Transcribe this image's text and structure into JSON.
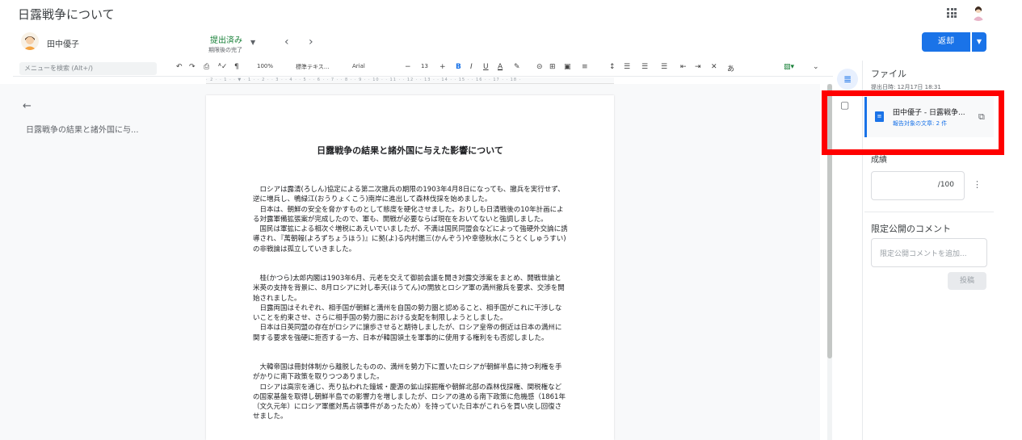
{
  "app": {
    "title": "日露戦争について"
  },
  "student": {
    "name": "田中優子",
    "status": "提出済み",
    "status_sub": "期限後の完了",
    "prev_label": "‹",
    "next_label": "›"
  },
  "actions": {
    "return_label": "返却"
  },
  "toolbar": {
    "search_placeholder": "メニューを検索 (Alt+/)",
    "zoom": "100%",
    "style": "標準テキス...",
    "font": "Arial",
    "font_size": "13",
    "input_tool": "あ"
  },
  "outline": {
    "items": [
      "日露戦争の結果と諸外国に与..."
    ]
  },
  "document": {
    "title": "日露戦争の結果と諸外国に与えた影響について",
    "paragraphs": [
      "　ロシアは露清(ろしん)協定による第二次撤兵の期限の1903年4月8日になっても、撤兵を実行せず、逆に増兵し、鴨緑江(おうりょくこう)南岸に進出して森林伐採を始めました。\n　日本は、朝鮮の安全を脅かすものとして態度を硬化させました。おりしも日清戦後の10年計画による対露軍備拡張案が完成したので、軍も、開戦が必要ならば現在をおいてないと強調しました。\n　国民は軍拡による相次ぐ増税にあえいでいましたが、不満は国民同盟会などによって強硬外交論に誘導され、『萬朝報(よろずちょうほう)』に拠(よ)る内村鑑三(かんぞう)や幸徳秋水(こうとくしゅうすい)の非戦論は孤立していきました。",
      "　桂(かつら)太郎内閣は1903年6月、元老を交えて御前会議を開き対露交渉案をまとめ、開戦世論と米英の支持を背景に、8月ロシアに対し奉天(ほうてん)の開放とロシア軍の満州撤兵を要求、交渉を開始されました。\n　日露両国はそれぞれ、相手国が朝鮮と満州を自国の勢力圏と認めること、相手国がこれに干渉しないことを約束させ、さらに相手国の勢力圏における支配を制限しようとしました。\n　日本は日英同盟の存在がロシアに譲歩させると期待しましたが、ロシア皇帝の側近は日本の満州に関する要求を強硬に拒否する一方、日本が韓国領土を軍事的に使用する権利をも否認しました。",
      "　大韓帝国は冊封体制から離脱したものの、満州を勢力下に置いたロシアが朝鮮半島に持つ利権を手がかりに南下政策を取りつつありました。\n　ロシアは高宗を通じ、売り払われた鐘城・慶源の鉱山採掘権や朝鮮北部の森林伐採権、関税権などの国家基盤を取得し朝鮮半島での影響力を増しましたが、ロシアの進める南下政策に危機感（1861年（文久元年）にロシア軍艦対馬占領事件があったため）を持っていた日本がこれらを買い戻し回復させました。"
    ]
  },
  "right_panel": {
    "files_title": "ファイル",
    "submitted_at": "提出日時: 12月17日 18:31",
    "file_name": "田中優子 - 日露戦争...",
    "file_sub": "報告対象の文章: 2 件",
    "grade_label": "成績",
    "grade_max": "/100",
    "private_comment_label": "限定公開のコメント",
    "comment_placeholder": "限定公開コメントを追加...",
    "post_label": "投稿"
  },
  "colors": {
    "accent": "#1a73e8",
    "status_green": "#188038",
    "highlight": "#ff0000"
  }
}
